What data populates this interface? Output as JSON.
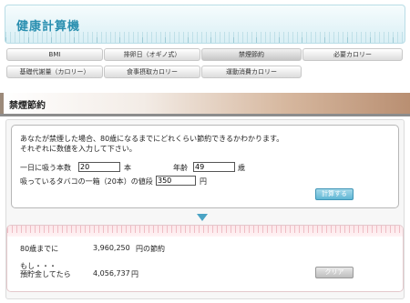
{
  "app_title": "健康計算機",
  "nav": {
    "row1": [
      "BMI",
      "排卵日（オギノ式）",
      "禁煙節約",
      "必要カロリー"
    ],
    "row2": [
      "基礎代謝量（カロリー）",
      "食事摂取カロリー",
      "運動消費カロリー"
    ],
    "active": "禁煙節約"
  },
  "section_title": "禁煙節約",
  "intro": {
    "line1": "あなたが禁煙した場合、80歳になるまでにどれくらい節約できるかわかります。",
    "line2": "それぞれに数値を入力して下さい。"
  },
  "form": {
    "per_day_label": "一日に吸う本数",
    "per_day_value": "20",
    "per_day_unit": "本",
    "age_label": "年齢",
    "age_value": "49",
    "age_unit": "歳",
    "price_label": "吸っているタバコの一箱（20本）の値段",
    "price_value": "350",
    "price_unit": "円"
  },
  "calc_button": "計算する",
  "result": {
    "row1_label": "80歳までに",
    "row1_value": "3,960,250",
    "row1_suffix": "円の節約",
    "moshi": "もし・・・",
    "row2_label": "預貯金してたら",
    "row2_value": "4,056,737",
    "row2_suffix": "円"
  },
  "clear_button": "クリア",
  "colors": {
    "accent": "#2a8fb0",
    "calc_button": "#5fb6d4",
    "arrow": "#4aa3c4",
    "result_border": "#e4c8cc"
  }
}
